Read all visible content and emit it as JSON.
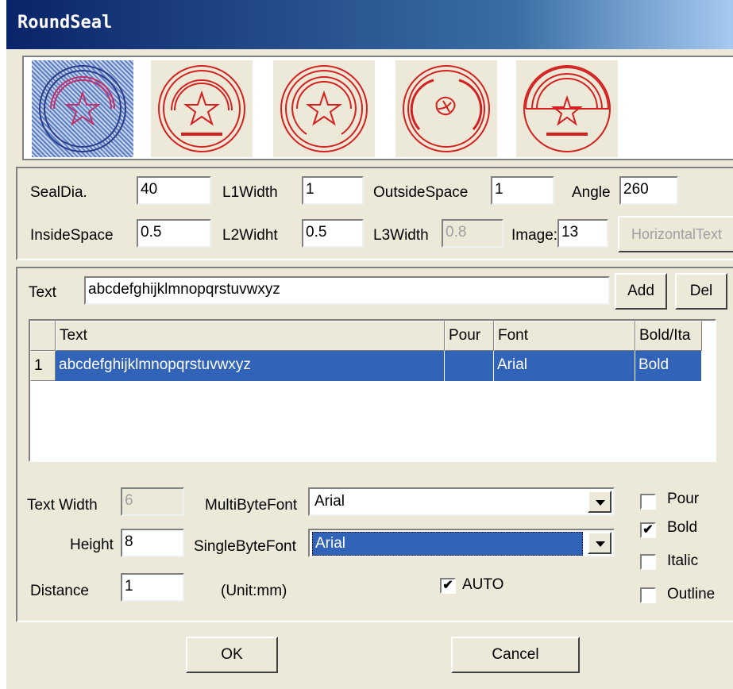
{
  "window": {
    "title": "RoundSeal"
  },
  "seal_styles": [
    {
      "name": "seal-style-1",
      "selected": true
    },
    {
      "name": "seal-style-2",
      "selected": false
    },
    {
      "name": "seal-style-3",
      "selected": false
    },
    {
      "name": "seal-style-4",
      "selected": false
    },
    {
      "name": "seal-style-5",
      "selected": false
    }
  ],
  "params": {
    "seal_dia_label": "SealDia.",
    "seal_dia_value": "40",
    "l1width_label": "L1Width",
    "l1width_value": "1",
    "outside_space_label": "OutsideSpace",
    "outside_space_value": "1",
    "angle_label": "Angle",
    "angle_value": "260",
    "inside_space_label": "InsideSpace",
    "inside_space_value": "0.5",
    "l2widht_label": "L2Widht",
    "l2widht_value": "0.5",
    "l3width_label": "L3Width",
    "l3width_value": "0.8",
    "image_label": "Image:",
    "image_value": "13",
    "horizontal_text_button": "HorizontalText"
  },
  "text_section": {
    "text_label": "Text",
    "text_value": "abcdefghijklmnopqrstuvwxyz",
    "add_button": "Add",
    "del_button": "Del"
  },
  "table": {
    "columns": [
      "Text",
      "Pour",
      "Font",
      "Bold/Ita"
    ],
    "rows": [
      {
        "num": "1",
        "text": "abcdefghijklmnopqrstuvwxyz",
        "pour": "",
        "font": "Arial",
        "bold_ita": "Bold"
      }
    ]
  },
  "font_section": {
    "text_width_label": "Text Width",
    "text_width_value": "6",
    "height_label": "Height",
    "height_value": "8",
    "distance_label": "Distance",
    "distance_value": "1",
    "unit_label": "(Unit:mm)",
    "multibyte_font_label": "MultiByteFont",
    "multibyte_font_value": "Arial",
    "singlebyte_font_label": "SingleByteFont",
    "singlebyte_font_value": "Arial",
    "auto_label": "AUTO",
    "auto_checked": "✔",
    "pour_label": "Pour",
    "pour_checked": "",
    "bold_label": "Bold",
    "bold_checked": "✔",
    "italic_label": "Italic",
    "italic_checked": "",
    "outline_label": "Outline",
    "outline_checked": ""
  },
  "footer": {
    "ok_button": "OK",
    "cancel_button": "Cancel"
  },
  "colors": {
    "seal_red": "#d42020",
    "selection_blue": "#3163b8",
    "dialog_bg": "#ece9d8"
  }
}
